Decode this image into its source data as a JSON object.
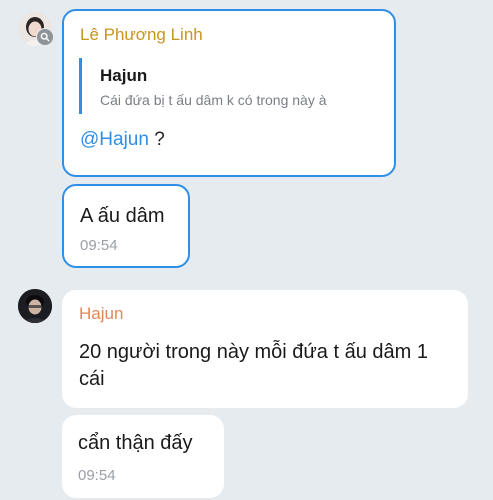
{
  "messages": {
    "first": {
      "sender": "Lê Phương Linh",
      "reply_name": "Hajun",
      "reply_text": "Cái đứa bị t ấu dâm k có trong này à",
      "mention": "@Hajun",
      "text_after_mention": " ?"
    },
    "second": {
      "text": "A ấu dâm",
      "time": "09:54"
    },
    "third": {
      "sender": "Hajun",
      "text": "20 người trong này mỗi đứa t ấu dâm 1 cái"
    },
    "fourth": {
      "text": "cẩn thận đấy",
      "time": "09:54"
    }
  },
  "colors": {
    "background": "#e6ebf0",
    "selection_border": "#2f8fe8",
    "sender_linh": "#c89520",
    "sender_hajun": "#e0885a",
    "mention": "#2f8fe8"
  },
  "icons": {
    "badge": "search-icon"
  }
}
